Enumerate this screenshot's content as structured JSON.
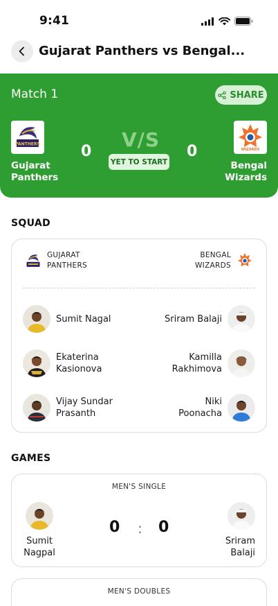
{
  "status_bar": {
    "time": "9:41"
  },
  "nav": {
    "title": "Gujarat Panthers vs Bengal..."
  },
  "match": {
    "label": "Match 1",
    "share_label": "SHARE",
    "vs_text": "V/S",
    "status": "YET TO START",
    "home": {
      "name_line1": "Gujarat",
      "name_line2": "Panthers",
      "score": "0",
      "logo_text": "PANTHERS"
    },
    "away": {
      "name_line1": "Bengal",
      "name_line2": "Wizards",
      "score": "0",
      "logo_text": "WIZARDS"
    }
  },
  "squad": {
    "title": "SQUAD",
    "home_team": {
      "line1": "GUJARAT",
      "line2": "PANTHERS"
    },
    "away_team": {
      "line1": "BENGAL",
      "line2": "WIZARDS"
    },
    "home_players": [
      {
        "line1": "Sumit Nagal",
        "line2": ""
      },
      {
        "line1": "Ekaterina",
        "line2": "Kasionova"
      },
      {
        "line1": "Vijay Sundar",
        "line2": "Prasanth"
      }
    ],
    "away_players": [
      {
        "line1": "Sriram Balaji",
        "line2": ""
      },
      {
        "line1": "Kamilla",
        "line2": "Rakhimova"
      },
      {
        "line1": "Niki",
        "line2": "Poonacha"
      }
    ]
  },
  "games": {
    "title": "GAMES",
    "list": [
      {
        "type": "MEN'S SINGLE",
        "home_line1": "Sumit",
        "home_line2": "Nagpal",
        "away_line1": "Sriram",
        "away_line2": "Balaji",
        "home_score": "0",
        "separator": ":",
        "away_score": "0"
      },
      {
        "type": "MEN'S DOUBLES"
      }
    ]
  },
  "colors": {
    "brand_green": "#2f9e32",
    "pill_bg": "#dff5dd",
    "share_bg": "#d7f0d6"
  }
}
